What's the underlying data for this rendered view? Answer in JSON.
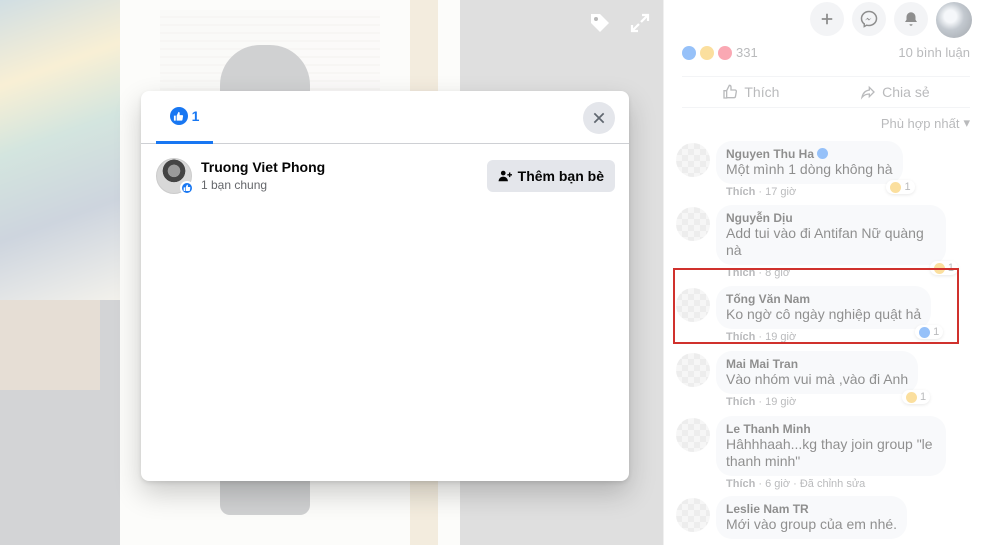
{
  "modal": {
    "tab_count": "1",
    "person": {
      "name": "Truong Viet Phong",
      "mutual": "1 bạn chung",
      "add_label": "Thêm bạn bè"
    }
  },
  "post": {
    "reaction_count": "331",
    "comment_count": "10 bình luận",
    "like_label": "Thích",
    "share_label": "Chia sẻ",
    "sort_label": "Phù hợp nhất"
  },
  "comments": [
    {
      "name": "Nguyen Thu Ha",
      "text": "Một mình 1 dòng không hà",
      "action": "Thích",
      "time": "17 giờ",
      "reactions": "1",
      "verified": true
    },
    {
      "name": "Nguyễn Dịu",
      "text": "Add tui vào đi Antifan Nữ quàng nà",
      "action": "Thích",
      "time": "8 giờ",
      "reactions": "1"
    },
    {
      "name": "Tống Văn Nam",
      "text": "Ko ngờ cô ngày nghiệp quật hả",
      "action": "Thích",
      "time": "19 giờ",
      "reactions": "1"
    },
    {
      "name": "Mai Mai Tran",
      "text": "Vào nhóm vui mà ,vào đi Anh",
      "action": "Thích",
      "time": "19 giờ",
      "reactions": "1"
    },
    {
      "name": "Le Thanh Minh",
      "text": "Hâhhhaah...kg thay join group \"le thanh minh\"",
      "action": "Thích",
      "time": "6 giờ · Đã chỉnh sửa"
    },
    {
      "name": "Leslie Nam TR",
      "text": "Mới vào group của em nhé."
    }
  ],
  "colors": {
    "facebook_blue": "#1877f2",
    "highlight_red": "#d0312d"
  }
}
